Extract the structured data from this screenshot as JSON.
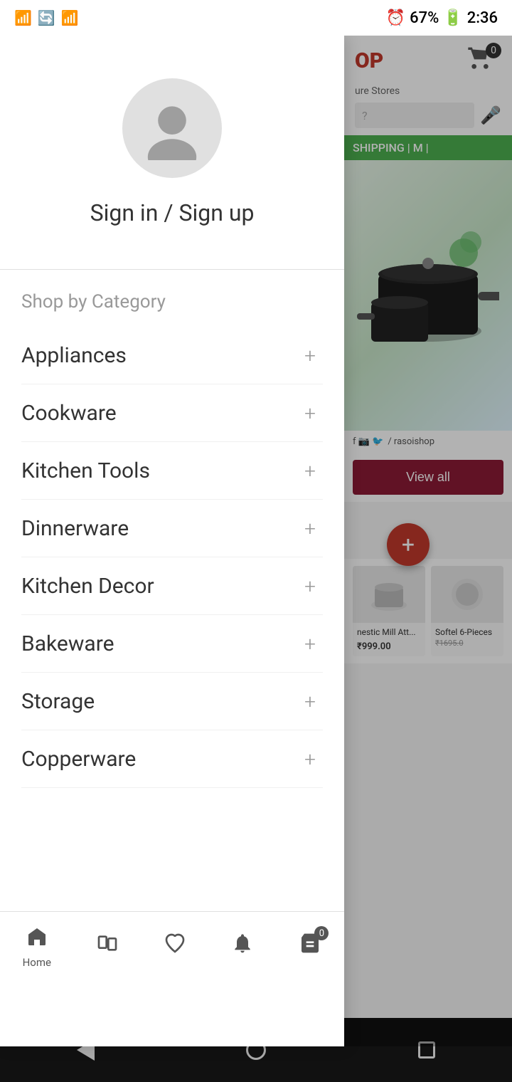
{
  "status_bar": {
    "time": "2:36",
    "battery": "67%",
    "icons_left": [
      "wifi",
      "sync",
      "signal"
    ]
  },
  "user": {
    "avatar_alt": "user avatar",
    "sign_in_label": "Sign in / Sign up"
  },
  "sidebar": {
    "section_title": "Shop by Category",
    "categories": [
      {
        "label": "Appliances",
        "id": "appliances"
      },
      {
        "label": "Cookware",
        "id": "cookware"
      },
      {
        "label": "Kitchen Tools",
        "id": "kitchen-tools"
      },
      {
        "label": "Dinnerware",
        "id": "dinnerware"
      },
      {
        "label": "Kitchen Decor",
        "id": "kitchen-decor"
      },
      {
        "label": "Bakeware",
        "id": "bakeware"
      },
      {
        "label": "Storage",
        "id": "storage"
      },
      {
        "label": "Copperware",
        "id": "copperware"
      }
    ]
  },
  "app": {
    "logo": "OP",
    "tagline": "ure Stores",
    "cart_count": "0",
    "shipping_banner": "SHIPPING | M |",
    "search_placeholder": "?",
    "social_handle": "/ rasoishop",
    "view_all_label": "View all",
    "float_plus_label": "+"
  },
  "products": [
    {
      "name": "nestic Mill Att...",
      "price": "999.00",
      "currency": "₹"
    },
    {
      "name": "Softel 6-Pieces",
      "price": "1695.0",
      "orig_price": "₹1695.0",
      "currency": "₹"
    }
  ],
  "bottom_nav": {
    "items": [
      {
        "label": "Home",
        "icon": "home",
        "id": "home"
      },
      {
        "label": "",
        "icon": "cards",
        "id": "cards"
      },
      {
        "label": "",
        "icon": "heart",
        "id": "wishlist"
      },
      {
        "label": "",
        "icon": "bell",
        "id": "notifications"
      },
      {
        "label": "",
        "icon": "cart",
        "id": "cart",
        "badge": "0"
      }
    ]
  }
}
